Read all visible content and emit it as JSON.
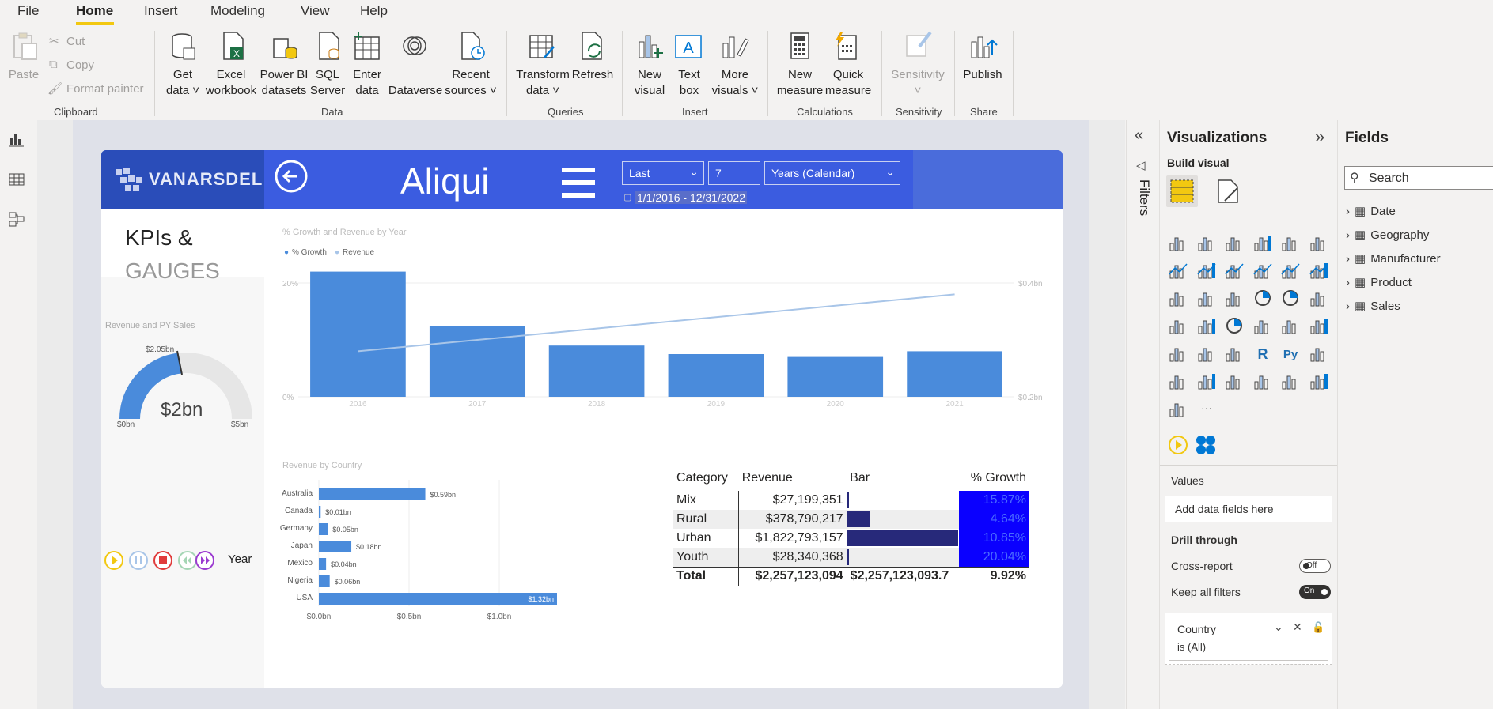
{
  "menu": {
    "file": "File",
    "home": "Home",
    "insert": "Insert",
    "modeling": "Modeling",
    "view": "View",
    "help": "Help"
  },
  "ribbon": {
    "paste": "Paste",
    "cut": "Cut",
    "copy": "Copy",
    "format_painter": "Format painter",
    "get_data": "Get\ndata ˅",
    "excel": "Excel\nworkbook",
    "pbi_datasets": "Power BI\ndatasets",
    "sql": "SQL\nServer",
    "enter_data": "Enter\ndata",
    "dataverse": "Dataverse",
    "recent": "Recent\nsources ˅",
    "transform": "Transform\ndata ˅",
    "refresh": "Refresh",
    "new_visual": "New\nvisual",
    "text_box": "Text\nbox",
    "more_visuals": "More\nvisuals ˅",
    "new_measure": "New\nmeasure",
    "quick_measure": "Quick\nmeasure",
    "sensitivity": "Sensitivity\n˅",
    "publish": "Publish",
    "groups": {
      "clipboard": "Clipboard",
      "data": "Data",
      "queries": "Queries",
      "insert": "Insert",
      "calculations": "Calculations",
      "sensitivity": "Sensitivity",
      "share": "Share"
    }
  },
  "report": {
    "logo": "VANARSDEL",
    "title": "Aliqui",
    "filter_mode": "Last",
    "filter_num": "7",
    "filter_unit": "Years (Calendar)",
    "date_range": "1/1/2016 - 12/31/2022",
    "side_title_1": "KPIs &",
    "side_title_2": "GAUGES",
    "gauge_title": "Revenue and PY Sales",
    "gauge_value": "$2bn",
    "gauge_target": "$2.05bn",
    "gauge_min": "$0bn",
    "gauge_max": "$5bn",
    "play_label": "Year"
  },
  "chart_data": [
    {
      "type": "bar",
      "title": "% Growth and Revenue by Year",
      "legend": [
        "% Growth",
        "Revenue"
      ],
      "categories": [
        "2016",
        "2017",
        "2018",
        "2019",
        "2020",
        "2021"
      ],
      "series": [
        {
          "name": "% Growth",
          "values": [
            22,
            12.5,
            9,
            7.5,
            7,
            8
          ]
        },
        {
          "name": "Revenue",
          "values": [
            0.28,
            0.3,
            0.32,
            0.34,
            0.36,
            0.38
          ]
        }
      ],
      "y_ticks": [
        "0%",
        "20%"
      ],
      "y2_ticks": [
        "$0.2bn",
        "$0.4bn"
      ],
      "ylim": [
        0,
        25
      ]
    },
    {
      "type": "bar",
      "title": "Revenue by Country",
      "categories": [
        "Australia",
        "Canada",
        "Germany",
        "Japan",
        "Mexico",
        "Nigeria",
        "USA"
      ],
      "values": [
        0.59,
        0.01,
        0.05,
        0.18,
        0.04,
        0.06,
        1.32
      ],
      "labels": [
        "$0.59bn",
        "$0.01bn",
        "$0.05bn",
        "$0.18bn",
        "$0.04bn",
        "$0.06bn",
        "$1.32bn"
      ],
      "x_ticks": [
        "$0.0bn",
        "$0.5bn",
        "$1.0bn"
      ],
      "xlim": [
        0,
        1.32
      ]
    }
  ],
  "table": {
    "headers": [
      "Category",
      "Revenue",
      "Bar",
      "% Growth"
    ],
    "rows": [
      {
        "cat": "Mix",
        "rev": "$27,199,351",
        "bar": 0.015,
        "growth": "15.87%"
      },
      {
        "cat": "Rural",
        "rev": "$378,790,217",
        "bar": 0.21,
        "growth": "4.64%"
      },
      {
        "cat": "Urban",
        "rev": "$1,822,793,157",
        "bar": 1.0,
        "growth": "10.85%"
      },
      {
        "cat": "Youth",
        "rev": "$28,340,368",
        "bar": 0.016,
        "growth": "20.04%"
      }
    ],
    "total": {
      "cat": "Total",
      "rev": "$2,257,123,094",
      "bar": "$2,257,123,093.7",
      "growth": "9.92%"
    }
  },
  "filters_label": "Filters",
  "viz": {
    "title": "Visualizations",
    "build": "Build visual",
    "values": "Values",
    "add_fields": "Add data fields here",
    "drill": "Drill through",
    "cross": "Cross-report",
    "cross_state": "Off",
    "keep": "Keep all filters",
    "keep_state": "On",
    "filter_field": "Country",
    "filter_value": "is (All)"
  },
  "fields": {
    "title": "Fields",
    "search_placeholder": "Search",
    "tables": [
      "Date",
      "Geography",
      "Manufacturer",
      "Product",
      "Sales"
    ]
  }
}
